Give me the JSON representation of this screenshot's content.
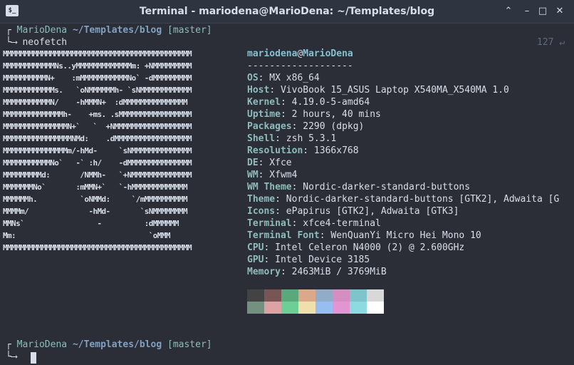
{
  "window": {
    "title": "Terminal - mariodena@MarioDena: ~/Templates/blog",
    "icon": "terminal-icon",
    "controls": {
      "shade": "⌃",
      "minimize": "–",
      "maximize": "□",
      "close": "✕"
    }
  },
  "prompt1": {
    "bracket_top": "┌",
    "bracket_bottom": "└⟶",
    "user": "MarioDena",
    "path": "~/Templates/blog",
    "branch": "[master]",
    "command": "neofetch",
    "status": "127 ↵"
  },
  "logo_lines": [
    "MMMMMMMMMMMMMMMMMMMMMMMMMMMMMMMMMMMMMMMMMMMM",
    "MMMMMMMMMMMMNs..yMMMMMMMMMMMMMm: +NMMMMMMMMM",
    "MMMMMMMMMMN+    :mMMMMMMMMMMMNo` -dMMMMMMMMM",
    "MMMMMMMMMMMMs.   `oNMMMMMMh- `sNMMMMMMMMMMMM",
    "MMMMMMMMMMMN/    -hMMMN+  :dMMMMMMMMMMMMMMM",
    "MMMMMMMMMMMMMMh-    +ms. .sMMMMMMMMMMMMMMMMM",
    "MMMMMMMMMMMMMMMN+`   `  +NMMMMMMMMMMMMMMMMMM",
    "MMMMMMMMMMMMMMMMNMd:    .dMMMMMMMMMMMMMMMMMM",
    "MMMMMMMMMMMMMMMm/-hMd-     `sNMMMMMMMMMMMMMM",
    "MMMMMMMMMMMNo`   -` :h/    -dMMMMMMMMMMMMMMM",
    "MMMMMMMMMd:       /NMMh-   `+NMMMMMMMMMMMMMM",
    "MMMMMMMNo`       :mMMN+`   `-hMMMMMMMMMMMMM",
    "MMMMMMh.          `oNMMd:     `/mMMMMMMMMMM",
    "MMMMm/              -hMd-       `sNMMMMMMMM",
    "MMNs`                 -          :dMMMMMM",
    "Mm:                               `oMMM",
    "MMMMMMMMMMMMMMMMMMMMMMMMMMMMMMMMMMMMMMMMMMMM"
  ],
  "info": {
    "user": "mariodena",
    "at": "@",
    "host": "MarioDena",
    "separator": "-------------------",
    "rows": [
      {
        "key": "OS",
        "value": ": MX x86_64"
      },
      {
        "key": "Host",
        "value": ": VivoBook 15_ASUS Laptop X540MA_X540MA 1.0"
      },
      {
        "key": "Kernel",
        "value": ": 4.19.0-5-amd64"
      },
      {
        "key": "Uptime",
        "value": ": 2 hours, 40 mins"
      },
      {
        "key": "Packages",
        "value": ": 2290 (dpkg)"
      },
      {
        "key": "Shell",
        "value": ": zsh 5.3.1"
      },
      {
        "key": "Resolution",
        "value": ": 1366x768"
      },
      {
        "key": "DE",
        "value": ": Xfce"
      },
      {
        "key": "WM",
        "value": ": Xfwm4"
      },
      {
        "key": "WM Theme",
        "value": ": Nordic-darker-standard-buttons"
      },
      {
        "key": "Theme",
        "value": ": Nordic-darker-standard-buttons [GTK2], Adwaita [G"
      },
      {
        "key": "Icons",
        "value": ": ePapirus [GTK2], Adwaita [GTK3]"
      },
      {
        "key": "Terminal",
        "value": ": xfce4-terminal"
      },
      {
        "key": "Terminal Font",
        "value": ": WenQuanYi Micro Hei Mono 10"
      },
      {
        "key": "CPU",
        "value": ": Intel Celeron N4000 (2) @ 2.600GHz"
      },
      {
        "key": "GPU",
        "value": ": Intel Device 3185"
      },
      {
        "key": "Memory",
        "value": ": 2463MiB / 3769MiB"
      }
    ]
  },
  "palette": {
    "row1": [
      "#434343",
      "#7a5555",
      "#5aa87c",
      "#dba88a",
      "#91acc9",
      "#d58ec1",
      "#7fc4cb",
      "#d8d8d8"
    ],
    "row2": [
      "#74907e",
      "#dba3a3",
      "#6dcf96",
      "#eedfad",
      "#98bdf0",
      "#e394d2",
      "#8ddbe0",
      "#ffffff"
    ]
  },
  "prompt2": {
    "bracket_top": "┌",
    "bracket_bottom": "└⟶",
    "user": "MarioDena",
    "path": "~/Templates/blog",
    "branch": "[master]"
  }
}
